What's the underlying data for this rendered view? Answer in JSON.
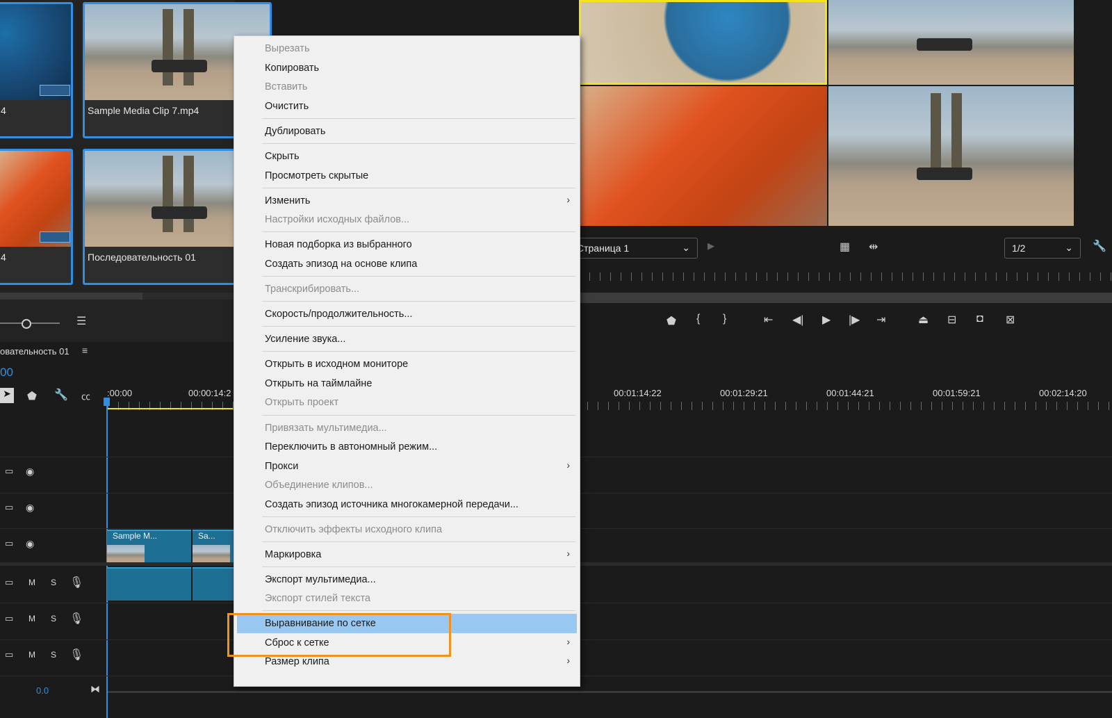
{
  "project_panel": {
    "clips": [
      {
        "name": "4"
      },
      {
        "name": "Sample Media Clip 7.mp4"
      },
      {
        "name": "4"
      },
      {
        "name": "Последовательность 01"
      }
    ]
  },
  "monitor": {
    "page_selector": "Страница 1",
    "resolution_selector": "1/2"
  },
  "timeline": {
    "sequence_name": "овательность 01",
    "timecode": "00",
    "ruler_labels": [
      ":00:00",
      "00:00:14:2",
      "00:01:14:22",
      "00:01:29:21",
      "00:01:44:21",
      "00:01:59:21",
      "00:02:14:20"
    ],
    "audio_track_m": "M",
    "audio_track_s": "S",
    "volume": "0.0",
    "clip1_label": "Sample M...",
    "clip2_label": "Sa..."
  },
  "context_menu": {
    "items": [
      {
        "label": "Вырезать",
        "enabled": false
      },
      {
        "label": "Копировать",
        "enabled": true
      },
      {
        "label": "Вставить",
        "enabled": false
      },
      {
        "label": "Очистить",
        "enabled": true
      },
      {
        "label": "Дублировать",
        "enabled": true
      },
      {
        "label": "Скрыть",
        "enabled": true
      },
      {
        "label": "Просмотреть скрытые",
        "enabled": true
      },
      {
        "label": "Изменить",
        "enabled": true,
        "submenu": true
      },
      {
        "label": "Настройки исходных файлов...",
        "enabled": false
      },
      {
        "label": "Новая подборка из выбранного",
        "enabled": true
      },
      {
        "label": "Создать эпизод на основе клипа",
        "enabled": true
      },
      {
        "label": "Транскрибировать...",
        "enabled": false
      },
      {
        "label": "Скорость/продолжительность...",
        "enabled": true
      },
      {
        "label": "Усиление звука...",
        "enabled": true
      },
      {
        "label": "Открыть в исходном мониторе",
        "enabled": true
      },
      {
        "label": "Открыть на таймлайне",
        "enabled": true
      },
      {
        "label": "Открыть проект",
        "enabled": false
      },
      {
        "label": "Привязать мультимедиа...",
        "enabled": false
      },
      {
        "label": "Переключить в автономный режим...",
        "enabled": true
      },
      {
        "label": "Прокси",
        "enabled": true,
        "submenu": true
      },
      {
        "label": "Объединение клипов...",
        "enabled": false
      },
      {
        "label": "Создать эпизод источника многокамерной передачи...",
        "enabled": true
      },
      {
        "label": "Отключить эффекты исходного клипа",
        "enabled": false
      },
      {
        "label": "Маркировка",
        "enabled": true,
        "submenu": true
      },
      {
        "label": "Экспорт мультимедиа...",
        "enabled": true
      },
      {
        "label": "Экспорт стилей текста",
        "enabled": false
      },
      {
        "label": "Выравнивание по сетке",
        "enabled": true,
        "highlighted": true
      },
      {
        "label": "Сброс к сетке",
        "enabled": true,
        "submenu": true
      },
      {
        "label": "Размер клипа",
        "enabled": true,
        "submenu": true
      }
    ]
  },
  "colors": {
    "accent_blue": "#2f8fe5",
    "highlight": "#99c9f3",
    "callout_orange": "#f0921c",
    "selection_yellow": "#f3e31b"
  }
}
